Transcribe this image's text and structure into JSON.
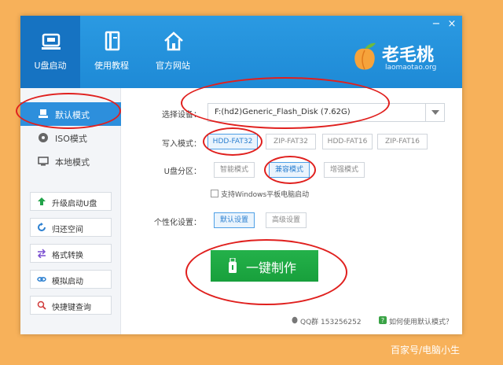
{
  "header": {
    "nav": [
      {
        "label": "U盘启动",
        "icon": "usb-drive-icon"
      },
      {
        "label": "使用教程",
        "icon": "book-icon"
      },
      {
        "label": "官方网站",
        "icon": "home-icon"
      }
    ],
    "window_controls": {
      "minimize": "−",
      "close": "×"
    },
    "logo": {
      "brand": "老毛桃",
      "url_text": "laomaotao.org"
    }
  },
  "sidebar": {
    "modes": [
      {
        "label": "默认模式",
        "icon": "drive-icon",
        "active": true
      },
      {
        "label": "ISO模式",
        "icon": "disc-icon",
        "active": false
      },
      {
        "label": "本地模式",
        "icon": "monitor-icon",
        "active": false
      }
    ],
    "tools": [
      {
        "label": "升级启动U盘",
        "icon": "arrow-up-icon"
      },
      {
        "label": "归还空间",
        "icon": "refresh-icon"
      },
      {
        "label": "格式转换",
        "icon": "swap-icon"
      },
      {
        "label": "模拟启动",
        "icon": "link-icon"
      },
      {
        "label": "快捷键查询",
        "icon": "search-icon"
      }
    ]
  },
  "form": {
    "device_label": "选择设备：",
    "device_value": "F:(hd2)Generic_Flash_Disk (7.62G)",
    "write_mode_label": "写入模式：",
    "write_modes": [
      "HDD-FAT32",
      "ZIP-FAT32",
      "HDD-FAT16",
      "ZIP-FAT16"
    ],
    "partition_label": "U盘分区：",
    "partition_modes": [
      "智能模式",
      "兼容模式",
      "增强模式"
    ],
    "tablet_checkbox_label": "支持Windows平板电脑启动",
    "personalize_label": "个性化设置：",
    "personalize_options": [
      "默认设置",
      "高级设置"
    ]
  },
  "main_button": {
    "label": "一键制作"
  },
  "footer": {
    "qq": "QQ群 153256252",
    "help": "如何使用默认模式？"
  },
  "watermark": "百家号/电脑小生",
  "colors": {
    "header_blue": "#2b9ae2",
    "accent_green": "#1fa845",
    "annotation_red": "#e0201e",
    "background_orange": "#f7b15a"
  }
}
